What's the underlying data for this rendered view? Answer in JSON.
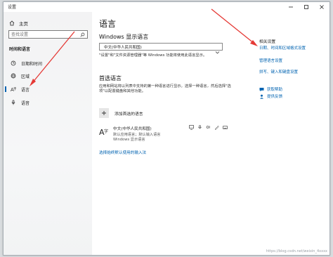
{
  "window": {
    "title": "设置"
  },
  "sidebar": {
    "home_label": "主页",
    "search_placeholder": "查找设置",
    "section_title": "时间和语言",
    "items": [
      {
        "label": "日期和时间",
        "icon": "clock-icon"
      },
      {
        "label": "区域",
        "icon": "globe-icon"
      },
      {
        "label": "语言",
        "icon": "language-icon",
        "active": true
      },
      {
        "label": "语音",
        "icon": "microphone-icon"
      }
    ]
  },
  "main": {
    "title": "语言",
    "display_language": {
      "heading": "Windows 显示语言",
      "selected": "中文(中华人民共和国)",
      "description": "\"设置\"和\"文件资源管理器\"等 Windows 功能将使用此语言显示。"
    },
    "preferred": {
      "heading": "首选语言",
      "description": "应用和网站将以列表中支持的第一种语言进行显示。选择一种语言，然后选择\"选项\"以配置键盘和其他功能。",
      "add_label": "添加首选的语言",
      "languages": [
        {
          "name": "中文(中华人民共和国)",
          "sub1": "默认应用语言；默认输入语言",
          "sub2": "Windows 显示语言"
        }
      ]
    },
    "link_bottom": "选择始终默认使用的输入法"
  },
  "related": {
    "title": "相关设置",
    "links": [
      "日期、时间和区域格式设置",
      "管理语言设置",
      "拼写、键入和键盘设置"
    ],
    "help": "获取帮助",
    "feedback": "提供反馈"
  },
  "watermark": "https://blog.csdn.net/weixin_4xxxx",
  "accent_color": "#0063b1",
  "arrow_color": "#e53935"
}
